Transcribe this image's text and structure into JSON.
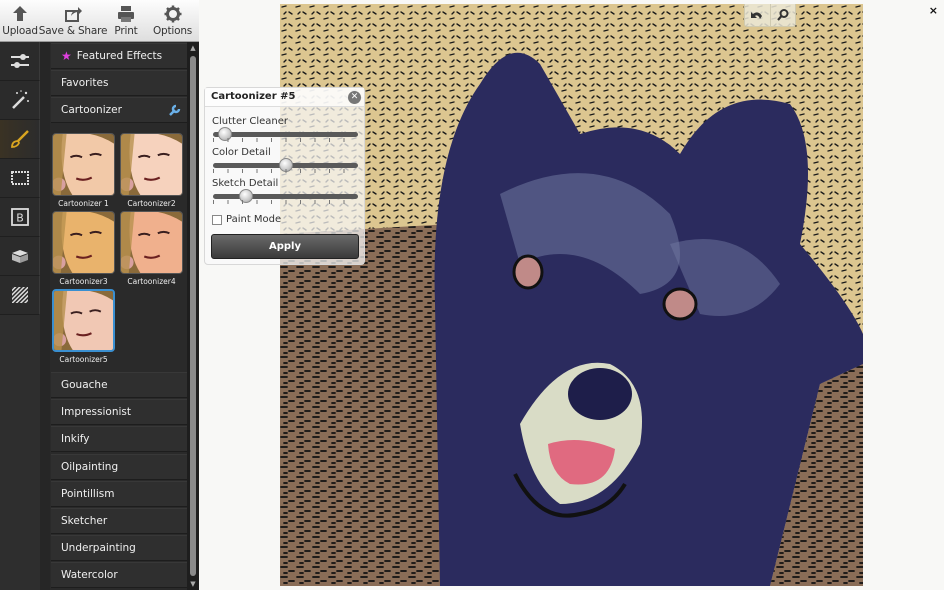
{
  "toolbar": {
    "buttons": [
      {
        "label": "Upload",
        "icon": "upload-arrow-icon"
      },
      {
        "label": "Save & Share",
        "icon": "share-icon"
      },
      {
        "label": "Print",
        "icon": "printer-icon"
      },
      {
        "label": "Options",
        "icon": "gear-icon"
      }
    ]
  },
  "rail": {
    "items": [
      {
        "icon": "adjustments-sliders-icon",
        "active": false
      },
      {
        "icon": "magic-wand-icon",
        "active": false
      },
      {
        "icon": "paintbrush-icon",
        "active": true
      },
      {
        "icon": "frame-icon",
        "active": false
      },
      {
        "icon": "text-b-icon",
        "active": false
      },
      {
        "icon": "overlay-box-icon",
        "active": false
      },
      {
        "icon": "texture-stripes-icon",
        "active": false
      }
    ]
  },
  "effects": {
    "featured_label": "Featured Effects",
    "favorites_label": "Favorites",
    "category_label": "Cartoonizer",
    "presets": [
      {
        "label": "Cartoonizer 1",
        "selected": false
      },
      {
        "label": "Cartoonizer2",
        "selected": false
      },
      {
        "label": "Cartoonizer3",
        "selected": false
      },
      {
        "label": "Cartoonizer4",
        "selected": false
      },
      {
        "label": "Cartoonizer5",
        "selected": true
      }
    ],
    "categories": [
      "Gouache",
      "Impressionist",
      "Inkify",
      "Oilpainting",
      "Pointillism",
      "Sketcher",
      "Underpainting",
      "Watercolor"
    ]
  },
  "dialog": {
    "title": "Cartoonizer #5",
    "sliders": [
      {
        "label": "Clutter Cleaner",
        "value": 0.04
      },
      {
        "label": "Color Detail",
        "value": 0.5
      },
      {
        "label": "Sketch Detail",
        "value": 0.2
      }
    ],
    "paint_mode_label": "Paint Mode",
    "paint_mode_checked": false,
    "apply_label": "Apply"
  },
  "canvas": {
    "close_label": "×",
    "colors": {
      "background_top": "#dcc690",
      "background_bottom": "#8a6d57",
      "dog_body": "#2b2b5e",
      "dog_highlight": "#6f78a0",
      "muzzle": "#d9dcc6",
      "tongue": "#e06a80"
    }
  }
}
